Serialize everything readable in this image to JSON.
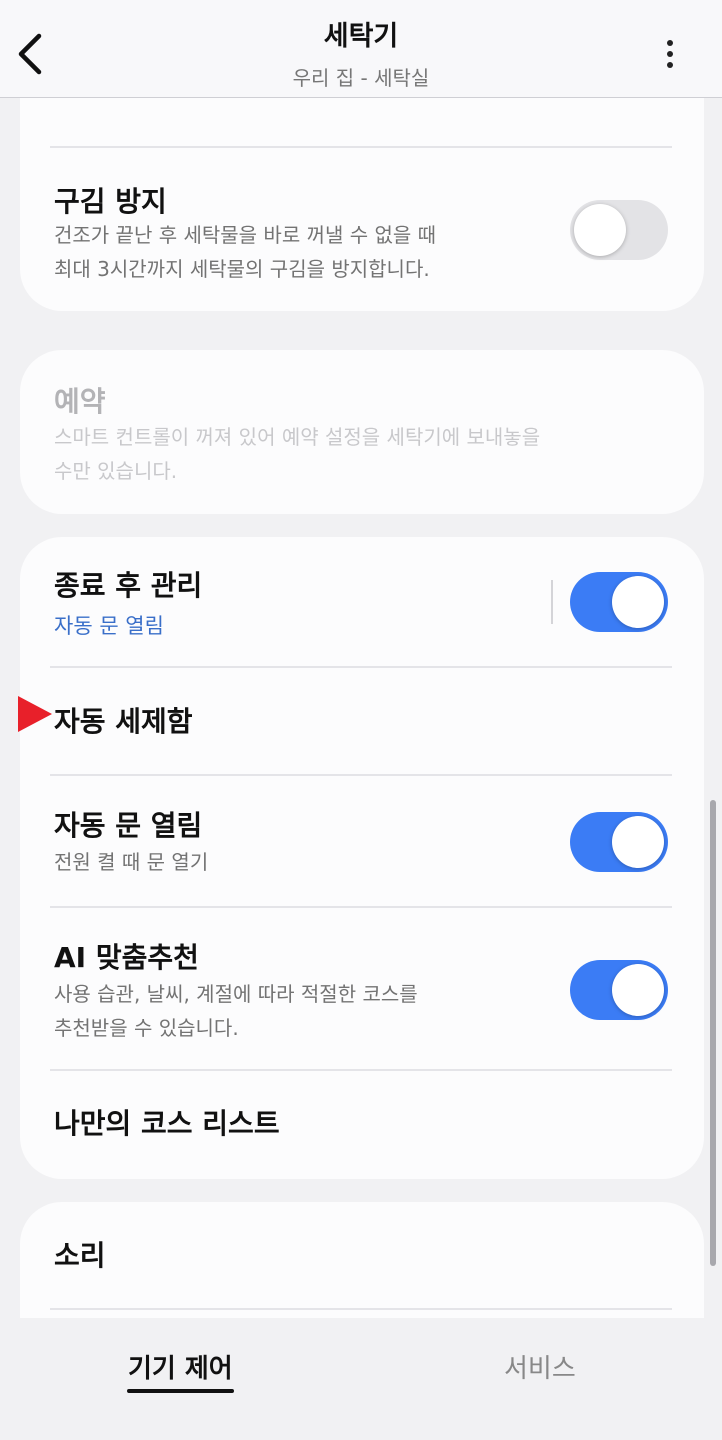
{
  "header": {
    "title": "세탁기",
    "subtitle": "우리 집 - 세탁실",
    "back_icon": "chevron-left-icon",
    "more_icon": "more-vertical-icon"
  },
  "settings": {
    "wrinkle": {
      "title": "구김 방지",
      "desc_line1": "건조가 끝난 후 세탁물을 바로 꺼낼 수 없을 때",
      "desc_line2": "최대 3시간까지 세탁물의 구김을 방지합니다.",
      "enabled": false
    },
    "reserve": {
      "title": "예약",
      "desc_line1": "스마트 컨트롤이 꺼져 있어 예약 설정을 세탁기에 보내놓을",
      "desc_line2": "수만 있습니다.",
      "disabled": true
    },
    "after_care": {
      "title": "종료 후 관리",
      "sub": "자동 문 열림",
      "enabled": true
    },
    "auto_detergent": {
      "title": "자동 세제함"
    },
    "auto_door": {
      "title": "자동 문 열림",
      "desc": "전원 켤 때 문 열기",
      "enabled": true
    },
    "ai_recommend": {
      "title": "AI 맞춤추천",
      "desc_line1": "사용 습관, 날씨, 계절에 따라 적절한 코스를",
      "desc_line2": "추천받을 수 있습니다.",
      "enabled": true
    },
    "my_courses": {
      "title": "나만의 코스 리스트"
    },
    "sound": {
      "title": "소리"
    }
  },
  "bottom_nav": {
    "tabs": [
      {
        "label": "기기 제어",
        "active": true
      },
      {
        "label": "서비스",
        "active": false
      }
    ]
  },
  "colors": {
    "accent": "#3b7cf5",
    "accent_text": "#3a6fc9",
    "marker": "#e8202a"
  }
}
